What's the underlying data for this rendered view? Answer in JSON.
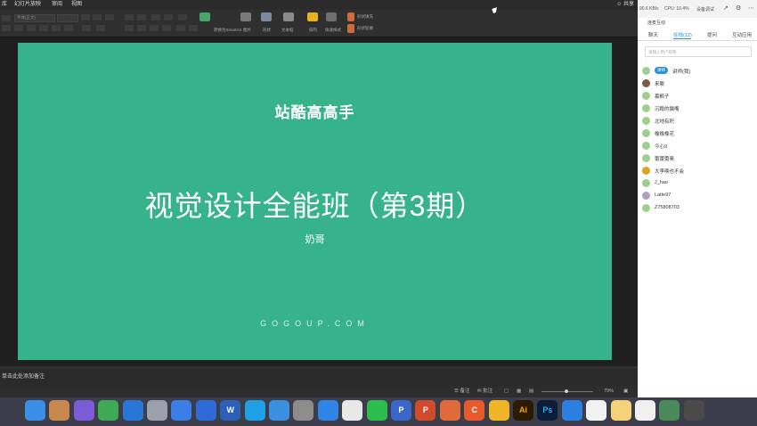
{
  "menubar": {
    "items": [
      "库",
      "幻灯片放映",
      "审阅",
      "视图"
    ],
    "share_label": "共享"
  },
  "ribbon": {
    "font_placeholder": "字体(正文)",
    "buttons": [
      "转换为SmartArt",
      "图片",
      "形状",
      "文本框",
      "排列",
      "快速样式",
      "形状填充",
      "形状轮廓"
    ]
  },
  "slide": {
    "brand": "站酷高高手",
    "title": "视觉设计全能班（第3期）",
    "author": "奶哥",
    "url": "GOGOUP.COM",
    "background": "#36b38a"
  },
  "notes": {
    "placeholder": "单击此处添加备注"
  },
  "status": {
    "notes_label": "备注",
    "comments_label": "批注",
    "zoom": "79%"
  },
  "panel": {
    "net_speed": "90.6 KB/s",
    "cpu": "CPU: 10.4%",
    "device": "设备调试",
    "live_label": "连麦互动",
    "tabs": [
      "聊天",
      "在线(12)",
      "提问",
      "互动应用"
    ],
    "search_placeholder": "请输入用户昵称",
    "teacher_badge": "讲师",
    "users": [
      "讲师(我)",
      "来聊",
      "慕枫子",
      "沉稳的猫嘴",
      "北地有积",
      "橡橡橡花",
      "今心9",
      "蕾蕾蕾奥",
      "大李唤也不会",
      "J_hao",
      "Latte97",
      "Z75808703"
    ]
  },
  "dock": {
    "apps": [
      "Finder",
      "Preview",
      "Siri",
      "Activity Monitor",
      "Baidu Netdisk",
      "Rocket",
      "Baidu",
      "Keynote",
      "Word",
      "QQ Browser",
      "Safari",
      "System Preferences",
      "Lark",
      "Chrome",
      "WeChat",
      "PP",
      "PowerPoint",
      "Toast",
      "C",
      "Sketch",
      "Ai",
      "Ps",
      "Cloud",
      "Photos",
      "Notes",
      "Image Viewer",
      "Terminal",
      "Trash"
    ],
    "colors": [
      "#3a8ee6",
      "#c9884e",
      "#7b5bd6",
      "#3eaa56",
      "#2a76d8",
      "#9aa1ad",
      "#3b7ee8",
      "#2f6bd8",
      "#2b5fb8",
      "#1ea0e6",
      "#3b8fe0",
      "#8c8c8c",
      "#2f84e6",
      "#e8e8e8",
      "#2cbd4f",
      "#3a66c8",
      "#d14a2c",
      "#e06a3a",
      "#e85a2a",
      "#f0b429",
      "#2b1b00",
      "#0a1e3a",
      "#2a7fe0",
      "#f2f2f2",
      "#f5d27a",
      "#f0f0f0",
      "#4a8a5a",
      "#4a4a4a"
    ],
    "labels": [
      "",
      "",
      "",
      "",
      "",
      "",
      "",
      "",
      "W",
      "",
      "",
      "",
      "",
      "",
      "",
      "P",
      "P",
      "",
      "C",
      "",
      "Ai",
      "Ps",
      "",
      "",
      "",
      "",
      "",
      ""
    ]
  }
}
